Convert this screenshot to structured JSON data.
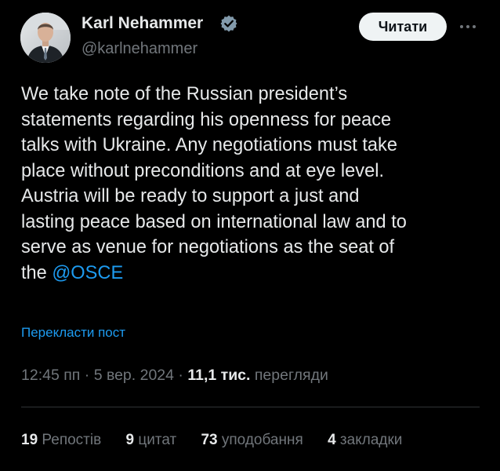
{
  "author": {
    "name": "Karl Nehammer",
    "handle": "@karlnehammer",
    "verified_color": "#829aab",
    "avatar_icon": "profile-photo"
  },
  "header": {
    "follow_label": "Читати",
    "more_icon": "more-dots-icon"
  },
  "post": {
    "lines": [
      "We take note of the Russian president’s",
      "statements regarding his openness for peace",
      "talks with Ukraine. Any negotiations must take",
      "place without preconditions and at eye level.",
      "Austria will be ready to support a just and",
      "lasting peace based on international law and to",
      "serve as venue for negotiations as the seat of"
    ],
    "last_line_prefix": "the ",
    "mention": "@OSCE",
    "translate_label": "Перекласти пост"
  },
  "meta": {
    "time": "12:45 пп",
    "sep1": " · ",
    "date": "5 вер. 2024",
    "sep2": " · ",
    "views_count": "11,1 тис.",
    "views_label": " перегляди"
  },
  "stats": [
    {
      "num": "19",
      "label": "Репостів"
    },
    {
      "num": "9",
      "label": "цитат"
    },
    {
      "num": "73",
      "label": "уподобання"
    },
    {
      "num": "4",
      "label": "закладки"
    }
  ],
  "colors": {
    "background": "#000000",
    "text": "#e7e9ea",
    "secondary": "#71767b",
    "link": "#1d9bf0",
    "divider": "#2f3336"
  }
}
